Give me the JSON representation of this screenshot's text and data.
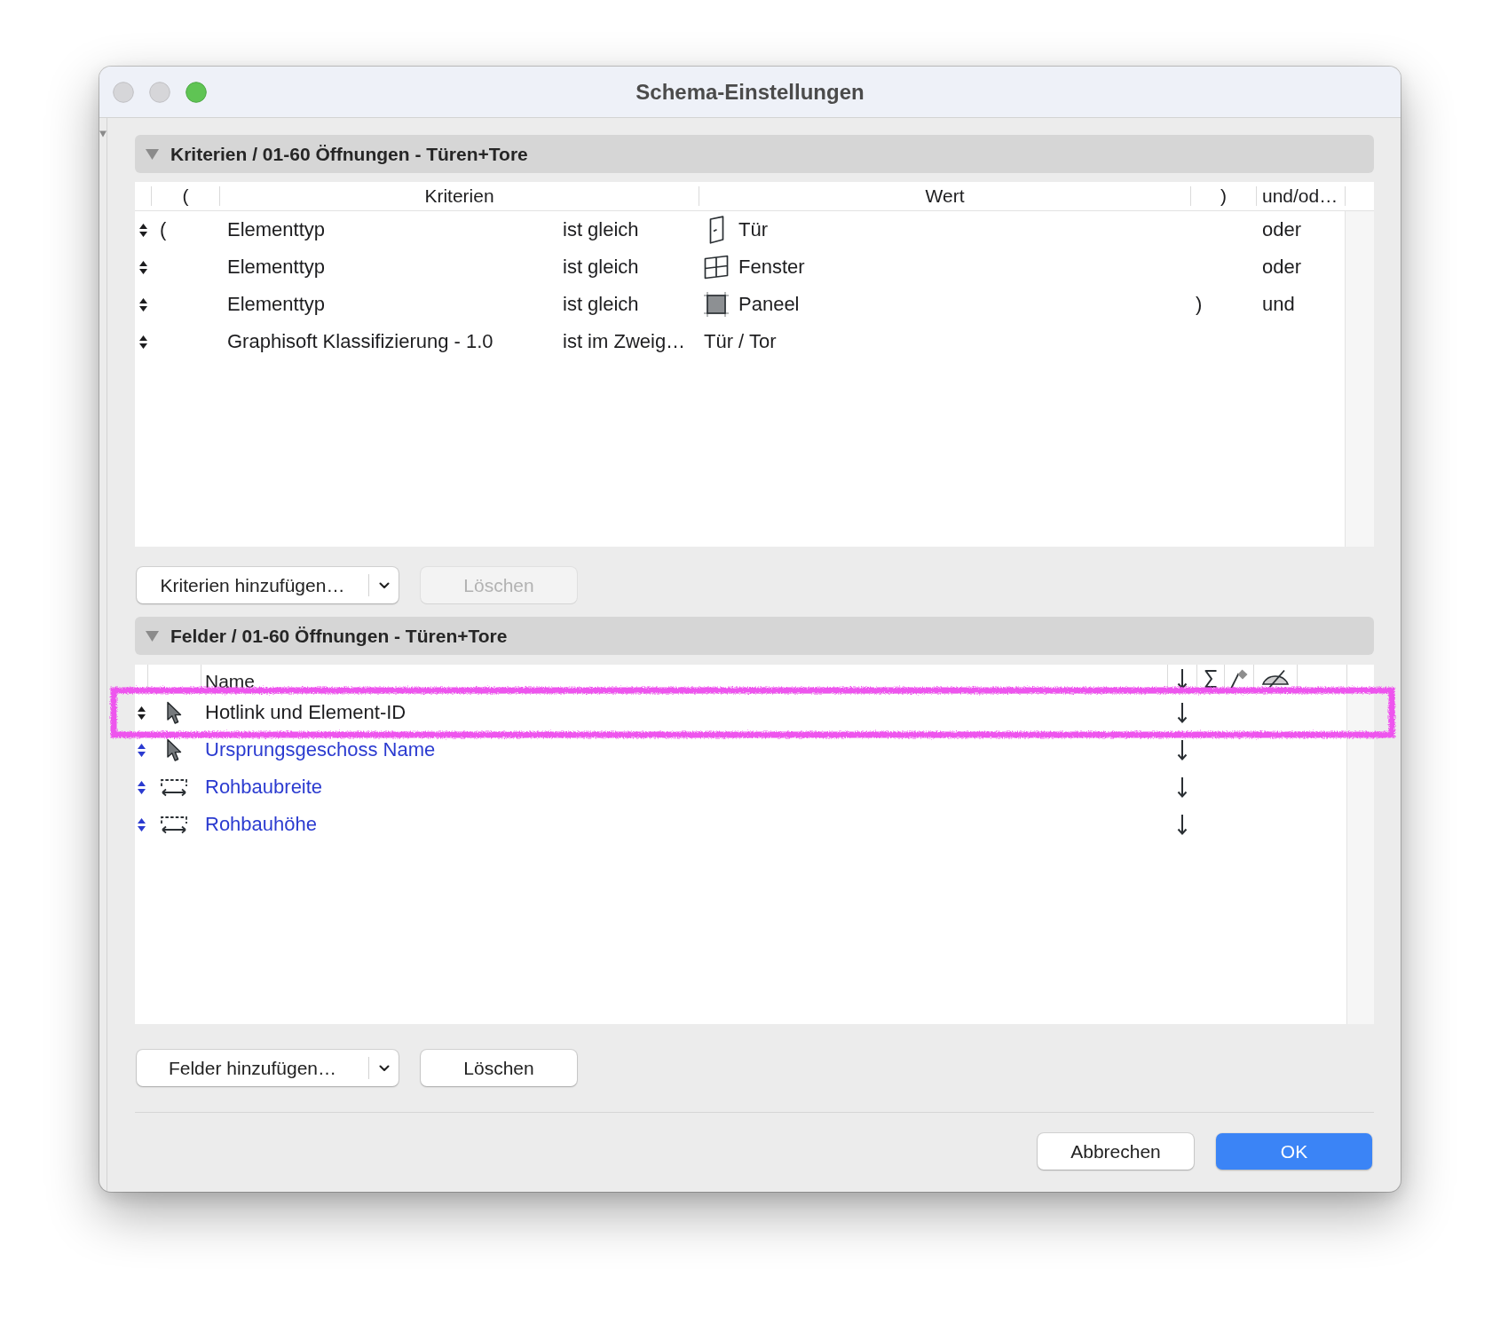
{
  "window": {
    "title": "Schema-Einstellungen"
  },
  "criteria": {
    "title": "Kriterien / 01-60 Öffnungen - Türen+Tore",
    "expanded": true,
    "columns": [
      "(",
      "Kriterien",
      "Wert",
      ")",
      "und/od…"
    ],
    "rows": [
      {
        "open": "(",
        "criterion": "Elementtyp",
        "operator": "ist gleich",
        "kind": "door",
        "value": "Tür",
        "logic": "oder"
      },
      {
        "criterion": "Elementtyp",
        "operator": "ist gleich",
        "kind": "window",
        "value": "Fenster",
        "logic": "oder"
      },
      {
        "criterion": "Elementtyp",
        "operator": "ist gleich",
        "kind": "panel",
        "value": "Paneel",
        "close": ")",
        "logic": "und"
      },
      {
        "criterion": "Graphisoft Klassifizierung - 1.0",
        "operator": "ist im Zweig…",
        "kind": "text",
        "value": "Tür / Tor"
      }
    ],
    "buttons": [
      {
        "label": "Kriterien hinzufügen…",
        "kind": "popup",
        "disabled": false
      },
      {
        "label": "Löschen",
        "kind": "push",
        "disabled": true
      }
    ]
  },
  "fields": {
    "title": "Felder / 01-60 Öffnungen - Türen+Tore",
    "expanded": true,
    "columns": [
      "Name"
    ],
    "rows": [
      {
        "kind": "pointer",
        "name": "Hotlink und Element-ID",
        "color": "#1d1d1f",
        "sorted": true,
        "highlighted": true
      },
      {
        "kind": "pointer",
        "name": "Ursprungsgeschoss Name",
        "color": "#2b3bd0",
        "sorted": true,
        "highlighted": false
      },
      {
        "kind": "dimension",
        "name": "Rohbaubreite",
        "color": "#2b3bd0",
        "sorted": true,
        "highlighted": false
      },
      {
        "kind": "dimension",
        "name": "Rohbauhöhe",
        "color": "#2b3bd0",
        "sorted": true,
        "highlighted": false
      }
    ],
    "buttons": [
      {
        "label": "Felder hinzufügen…",
        "kind": "popup",
        "disabled": false
      },
      {
        "label": "Löschen",
        "kind": "push",
        "disabled": false
      }
    ]
  },
  "footer": {
    "buttons": [
      {
        "label": "Abbrechen",
        "kind": "push",
        "disabled": false
      },
      {
        "label": "OK",
        "kind": "primary",
        "disabled": false
      }
    ]
  }
}
